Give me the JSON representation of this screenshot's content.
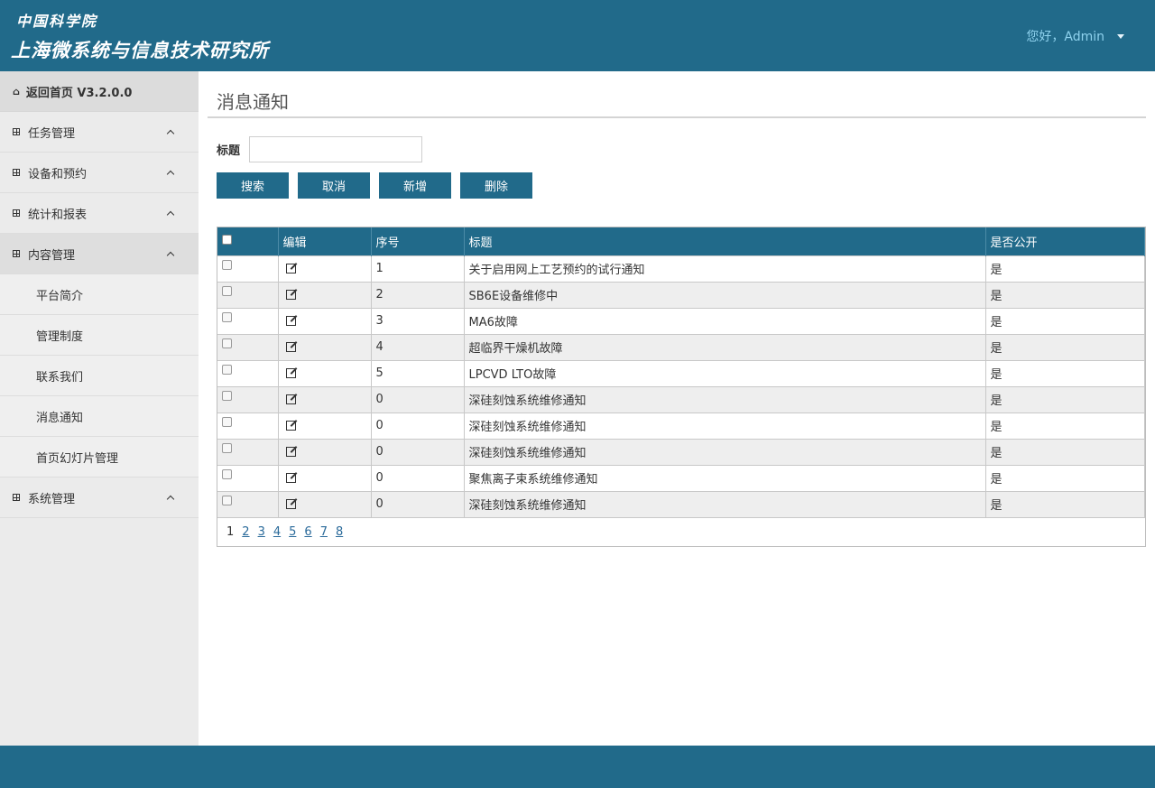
{
  "header": {
    "logo_line1": "中国科学院",
    "logo_line2": "上海微系统与信息技术研究所",
    "user_greeting": "您好，Admin"
  },
  "sidebar": {
    "home": "返回首页 V3.2.0.0",
    "items": [
      {
        "label": "任务管理"
      },
      {
        "label": "设备和预约"
      },
      {
        "label": "统计和报表"
      },
      {
        "label": "内容管理"
      },
      {
        "label": "系统管理"
      }
    ],
    "content_sub": [
      "平台简介",
      "管理制度",
      "联系我们",
      "消息通知",
      "首页幻灯片管理"
    ]
  },
  "main": {
    "page_title": "消息通知",
    "search_label": "标题",
    "search_value": "",
    "buttons": {
      "search": "搜索",
      "cancel": "取消",
      "add": "新增",
      "delete": "删除"
    }
  },
  "table": {
    "columns": [
      "编辑",
      "序号",
      "标题",
      "是否公开"
    ],
    "rows": [
      {
        "seq": "1",
        "title": "关于启用网上工艺预约的试行通知",
        "public": "是"
      },
      {
        "seq": "2",
        "title": "SB6E设备维修中",
        "public": "是"
      },
      {
        "seq": "3",
        "title": "MA6故障",
        "public": "是"
      },
      {
        "seq": "4",
        "title": "超临界干燥机故障",
        "public": "是"
      },
      {
        "seq": "5",
        "title": "LPCVD LTO故障",
        "public": "是"
      },
      {
        "seq": "0",
        "title": "深硅刻蚀系统维修通知",
        "public": "是"
      },
      {
        "seq": "0",
        "title": "深硅刻蚀系统维修通知",
        "public": "是"
      },
      {
        "seq": "0",
        "title": "深硅刻蚀系统维修通知",
        "public": "是"
      },
      {
        "seq": "0",
        "title": "聚焦离子束系统维修通知",
        "public": "是"
      },
      {
        "seq": "0",
        "title": "深硅刻蚀系统维修通知",
        "public": "是"
      }
    ]
  },
  "pager": {
    "current": "1",
    "pages": [
      "2",
      "3",
      "4",
      "5",
      "6",
      "7",
      "8"
    ]
  }
}
